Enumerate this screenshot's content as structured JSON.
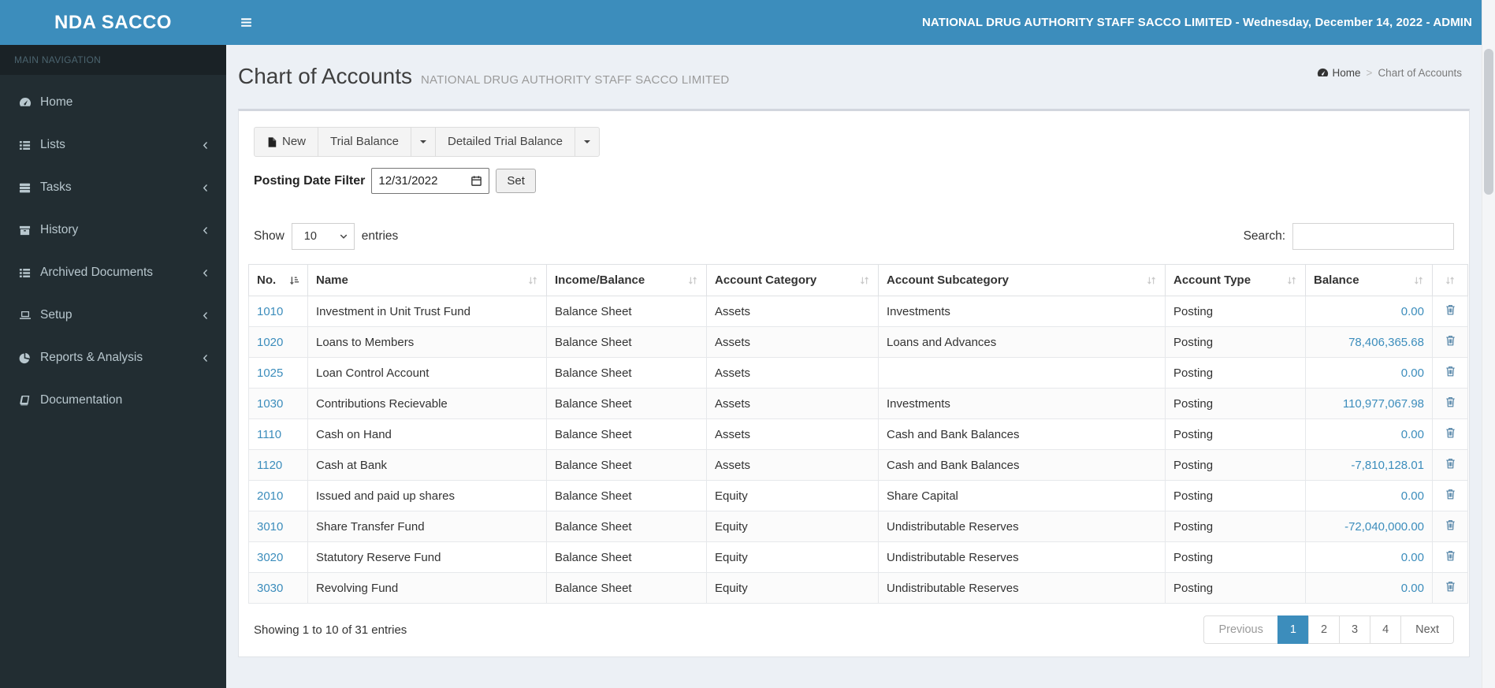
{
  "navbar": {
    "brand": "NDA SACCO",
    "title": "NATIONAL DRUG AUTHORITY STAFF SACCO LIMITED - Wednesday, December 14, 2022 - ADMIN"
  },
  "sidebar": {
    "header": "MAIN NAVIGATION",
    "items": [
      {
        "label": "Home",
        "icon": "dashboard-icon",
        "expandable": false
      },
      {
        "label": "Lists",
        "icon": "list-icon",
        "expandable": true
      },
      {
        "label": "Tasks",
        "icon": "tasks-icon",
        "expandable": true
      },
      {
        "label": "History",
        "icon": "archive-icon",
        "expandable": true
      },
      {
        "label": "Archived Documents",
        "icon": "list-icon",
        "expandable": true
      },
      {
        "label": "Setup",
        "icon": "laptop-icon",
        "expandable": true
      },
      {
        "label": "Reports & Analysis",
        "icon": "pie-chart-icon",
        "expandable": true
      },
      {
        "label": "Documentation",
        "icon": "book-icon",
        "expandable": false
      }
    ]
  },
  "content_header": {
    "title": "Chart of Accounts",
    "subtitle": "NATIONAL DRUG AUTHORITY STAFF SACCO LIMITED",
    "breadcrumb": {
      "home": "Home",
      "separator": ">",
      "current": "Chart of Accounts"
    }
  },
  "toolbar": {
    "new_label": "New",
    "trial_balance_label": "Trial Balance",
    "detailed_trial_balance_label": "Detailed Trial Balance"
  },
  "filter": {
    "label": "Posting Date Filter",
    "date_value": "12/31/2022",
    "set_label": "Set"
  },
  "table_controls": {
    "show_label": "Show",
    "page_length": "10",
    "entries_label": "entries",
    "search_label": "Search:",
    "search_value": ""
  },
  "table": {
    "columns": [
      {
        "label": "No.",
        "sort": "asc"
      },
      {
        "label": "Name",
        "sort": "none"
      },
      {
        "label": "Income/Balance",
        "sort": "none"
      },
      {
        "label": "Account Category",
        "sort": "none"
      },
      {
        "label": "Account Subcategory",
        "sort": "none"
      },
      {
        "label": "Account Type",
        "sort": "none"
      },
      {
        "label": "Balance",
        "sort": "none"
      },
      {
        "label": "",
        "sort": "none"
      }
    ],
    "rows": [
      {
        "no": "1010",
        "name": "Investment in Unit Trust Fund",
        "income_balance": "Balance Sheet",
        "category": "Assets",
        "subcategory": "Investments",
        "type": "Posting",
        "balance": "0.00"
      },
      {
        "no": "1020",
        "name": "Loans to Members",
        "income_balance": "Balance Sheet",
        "category": "Assets",
        "subcategory": "Loans and Advances",
        "type": "Posting",
        "balance": "78,406,365.68"
      },
      {
        "no": "1025",
        "name": "Loan Control Account",
        "income_balance": "Balance Sheet",
        "category": "Assets",
        "subcategory": "",
        "type": "Posting",
        "balance": "0.00"
      },
      {
        "no": "1030",
        "name": "Contributions Recievable",
        "income_balance": "Balance Sheet",
        "category": "Assets",
        "subcategory": "Investments",
        "type": "Posting",
        "balance": "110,977,067.98"
      },
      {
        "no": "1110",
        "name": "Cash on Hand",
        "income_balance": "Balance Sheet",
        "category": "Assets",
        "subcategory": "Cash and Bank Balances",
        "type": "Posting",
        "balance": "0.00"
      },
      {
        "no": "1120",
        "name": "Cash at Bank",
        "income_balance": "Balance Sheet",
        "category": "Assets",
        "subcategory": "Cash and Bank Balances",
        "type": "Posting",
        "balance": "-7,810,128.01"
      },
      {
        "no": "2010",
        "name": "Issued and paid up shares",
        "income_balance": "Balance Sheet",
        "category": "Equity",
        "subcategory": "Share Capital",
        "type": "Posting",
        "balance": "0.00"
      },
      {
        "no": "3010",
        "name": "Share Transfer Fund",
        "income_balance": "Balance Sheet",
        "category": "Equity",
        "subcategory": "Undistributable Reserves",
        "type": "Posting",
        "balance": "-72,040,000.00"
      },
      {
        "no": "3020",
        "name": "Statutory Reserve Fund",
        "income_balance": "Balance Sheet",
        "category": "Equity",
        "subcategory": "Undistributable Reserves",
        "type": "Posting",
        "balance": "0.00"
      },
      {
        "no": "3030",
        "name": "Revolving Fund",
        "income_balance": "Balance Sheet",
        "category": "Equity",
        "subcategory": "Undistributable Reserves",
        "type": "Posting",
        "balance": "0.00"
      }
    ]
  },
  "footer": {
    "info": "Showing 1 to 10 of 31 entries",
    "pagination": {
      "previous_label": "Previous",
      "pages": [
        "1",
        "2",
        "3",
        "4"
      ],
      "active_page": "1",
      "next_label": "Next"
    }
  },
  "colors": {
    "accent": "#3c8dbc",
    "sidebar_bg": "#222d32",
    "sidebar_header_bg": "#1a2226",
    "content_bg": "#ecf0f5",
    "link": "#3c8dbc",
    "active_page_bg": "#3c8dbc"
  }
}
